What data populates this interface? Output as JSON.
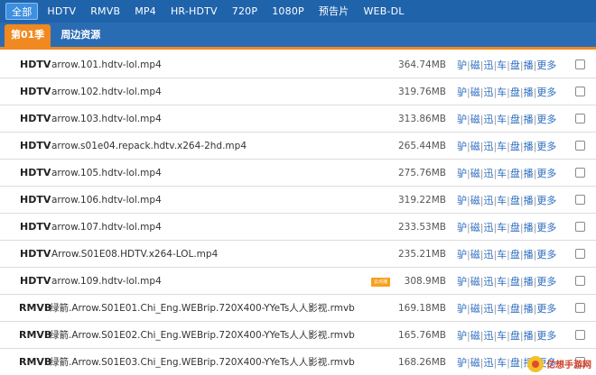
{
  "format_tabs": [
    {
      "label": "全部",
      "active": true
    },
    {
      "label": "HDTV",
      "active": false
    },
    {
      "label": "RMVB",
      "active": false
    },
    {
      "label": "MP4",
      "active": false
    },
    {
      "label": "HR-HDTV",
      "active": false
    },
    {
      "label": "720P",
      "active": false
    },
    {
      "label": "1080P",
      "active": false
    },
    {
      "label": "预告片",
      "active": false
    },
    {
      "label": "WEB-DL",
      "active": false
    }
  ],
  "season_tabs": [
    {
      "label": "第01季",
      "active": true
    },
    {
      "label": "周边资源",
      "active": false
    }
  ],
  "links": [
    "驴",
    "磁",
    "迅",
    "车",
    "盘",
    "播",
    "更多"
  ],
  "files": [
    {
      "format": "HDTV",
      "name": "arrow.101.hdtv-lol.mp4",
      "size": "364.74MB",
      "badge": ""
    },
    {
      "format": "HDTV",
      "name": "arrow.102.hdtv-lol.mp4",
      "size": "319.76MB",
      "badge": ""
    },
    {
      "format": "HDTV",
      "name": "arrow.103.hdtv-lol.mp4",
      "size": "313.86MB",
      "badge": ""
    },
    {
      "format": "HDTV",
      "name": "arrow.s01e04.repack.hdtv.x264-2hd.mp4",
      "size": "265.44MB",
      "badge": ""
    },
    {
      "format": "HDTV",
      "name": "arrow.105.hdtv-lol.mp4",
      "size": "275.76MB",
      "badge": ""
    },
    {
      "format": "HDTV",
      "name": "arrow.106.hdtv-lol.mp4",
      "size": "319.22MB",
      "badge": ""
    },
    {
      "format": "HDTV",
      "name": "arrow.107.hdtv-lol.mp4",
      "size": "233.53MB",
      "badge": ""
    },
    {
      "format": "HDTV",
      "name": "Arrow.S01E08.HDTV.x264-LOL.mp4",
      "size": "235.21MB",
      "badge": ""
    },
    {
      "format": "HDTV",
      "name": "arrow.109.hdtv-lol.mp4",
      "size": "308.9MB",
      "badge": "云点播"
    },
    {
      "format": "RMVB",
      "name": "绿箭.Arrow.S01E01.Chi_Eng.WEBrip.720X400-YYeTs人人影视.rmvb",
      "size": "169.18MB",
      "badge": ""
    },
    {
      "format": "RMVB",
      "name": "绿箭.Arrow.S01E02.Chi_Eng.WEBrip.720X400-YYeTs人人影视.rmvb",
      "size": "165.76MB",
      "badge": ""
    },
    {
      "format": "RMVB",
      "name": "绿箭.Arrow.S01E03.Chi_Eng.WEBrip.720X400-YYeTs人人影视.rmvb",
      "size": "168.26MB",
      "badge": ""
    }
  ],
  "watermark": {
    "text": "亿想手游网"
  },
  "colors": {
    "nav_bg": "#1f63ab",
    "accent": "#f0891f",
    "link": "#2b6cc0"
  }
}
